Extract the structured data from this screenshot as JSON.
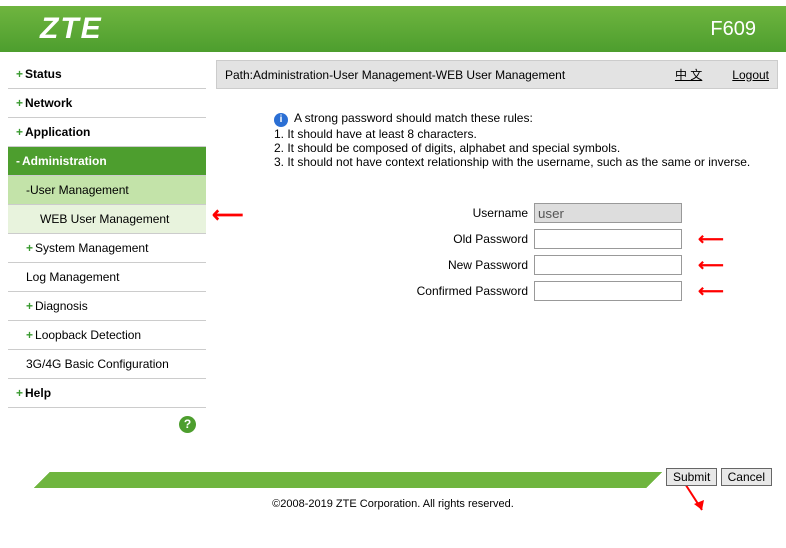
{
  "header": {
    "logo": "ZTE",
    "model": "F609"
  },
  "sidebar": {
    "status": "Status",
    "network": "Network",
    "application": "Application",
    "administration": "Administration",
    "user_mgmt": "User Management",
    "web_user_mgmt": "WEB User Management",
    "system_mgmt": "System Management",
    "log_mgmt": "Log Management",
    "diagnosis": "Diagnosis",
    "loopback": "Loopback Detection",
    "g34_config": "3G/4G Basic Configuration",
    "help": "Help"
  },
  "pathbar": {
    "prefix": "Path:",
    "path": "Administration-User Management-WEB User Management",
    "lang": "中 文",
    "logout": "Logout"
  },
  "info": {
    "title": "A strong password should match these rules:",
    "r1": "1. It should have at least 8 characters.",
    "r2": "2. It should be composed of digits, alphabet and special symbols.",
    "r3": "3. It should not have context relationship with the username, such as the same or inverse."
  },
  "form": {
    "username_label": "Username",
    "username_value": "user",
    "old_pw_label": "Old Password",
    "new_pw_label": "New Password",
    "confirm_pw_label": "Confirmed Password"
  },
  "buttons": {
    "submit": "Submit",
    "cancel": "Cancel"
  },
  "footer": "©2008-2019 ZTE Corporation. All rights reserved."
}
